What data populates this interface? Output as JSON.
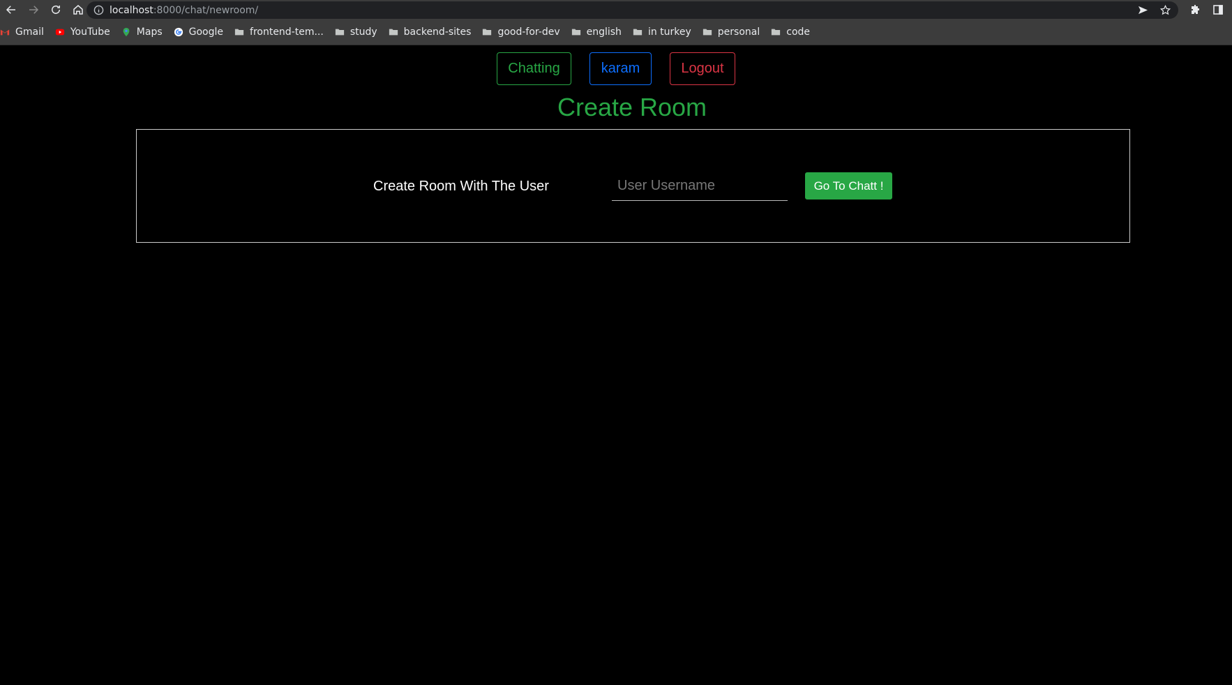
{
  "browser": {
    "url_host": "localhost",
    "url_rest": ":8000/chat/newroom/",
    "bookmarks": [
      {
        "label": "Gmail",
        "icon": "gmail-icon"
      },
      {
        "label": "YouTube",
        "icon": "youtube-icon"
      },
      {
        "label": "Maps",
        "icon": "maps-icon"
      },
      {
        "label": "Google",
        "icon": "google-icon"
      },
      {
        "label": "frontend-tem...",
        "icon": "folder-icon"
      },
      {
        "label": "study",
        "icon": "folder-icon"
      },
      {
        "label": "backend-sites",
        "icon": "folder-icon"
      },
      {
        "label": "good-for-dev",
        "icon": "folder-icon"
      },
      {
        "label": "english",
        "icon": "folder-icon"
      },
      {
        "label": "in turkey",
        "icon": "folder-icon"
      },
      {
        "label": "personal",
        "icon": "folder-icon"
      },
      {
        "label": "code",
        "icon": "folder-icon"
      }
    ]
  },
  "nav": {
    "chatting": "Chatting",
    "user": "karam",
    "logout": "Logout"
  },
  "page": {
    "title": "Create Room",
    "label": "Create Room With The User",
    "input_placeholder": "User Username",
    "input_value": "",
    "button": "Go To Chatt !"
  },
  "colors": {
    "green": "#28a745",
    "blue": "#0d6efd",
    "red": "#dc3545",
    "background": "#000000"
  }
}
